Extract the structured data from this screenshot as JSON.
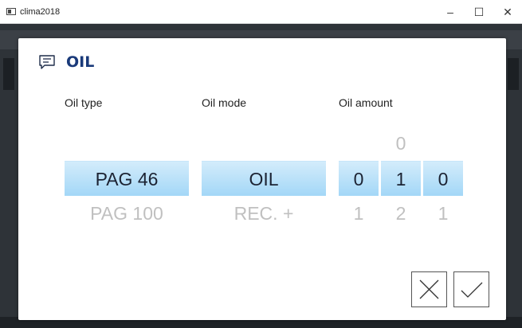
{
  "window": {
    "title": "clima2018",
    "minimize": "–",
    "maximize": "☐",
    "close": "✕"
  },
  "dialog": {
    "title": "OIL",
    "icon": "message-icon",
    "columns": {
      "type": {
        "label": "Oil type",
        "selected": "PAG 46",
        "next": "PAG 100"
      },
      "mode": {
        "label": "Oil mode",
        "selected": "OIL",
        "next": "REC. +"
      },
      "amount": {
        "label": "Oil amount",
        "digits": [
          {
            "above": "",
            "selected": "0",
            "next": "1"
          },
          {
            "above": "0",
            "selected": "1",
            "next": "2"
          },
          {
            "above": "",
            "selected": "0",
            "next": "1"
          }
        ]
      }
    },
    "buttons": {
      "cancel": "cancel-icon",
      "confirm": "check-icon"
    }
  },
  "colors": {
    "selection": "#a3d7f7",
    "title": "#1a3a7a",
    "faded": "#c0c0c0"
  }
}
